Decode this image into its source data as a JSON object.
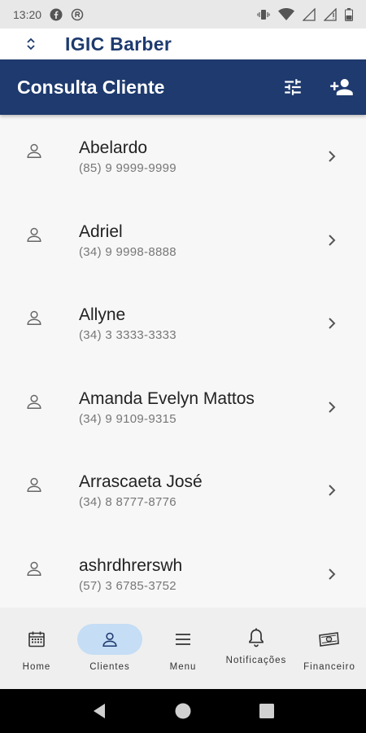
{
  "status_bar": {
    "time": "13:20",
    "icons": [
      "facebook-icon",
      "data-saver-icon",
      "vibrate-icon",
      "wifi-icon",
      "signal-icon",
      "battery-icon"
    ]
  },
  "app_bar": {
    "title": "IGIC Barber",
    "switch_icon": "unfold-icon"
  },
  "header": {
    "title": "Consulta Cliente",
    "filter_icon": "tune-icon",
    "add_icon": "person-add-icon"
  },
  "clients": [
    {
      "name": "Abelardo",
      "phone": "(85) 9 9999-9999"
    },
    {
      "name": "Adriel",
      "phone": "(34) 9 9998-8888"
    },
    {
      "name": "Allyne",
      "phone": "(34) 3 3333-3333"
    },
    {
      "name": "Amanda Evelyn Mattos",
      "phone": "(34) 9 9109-9315"
    },
    {
      "name": "Arrascaeta José",
      "phone": "(34) 8 8777-8776"
    },
    {
      "name": "ashrdhrerswh",
      "phone": "(57) 3 6785-3752"
    }
  ],
  "bottom_nav": [
    {
      "label": "Home",
      "icon": "calendar-icon"
    },
    {
      "label": "Clientes",
      "icon": "person-icon",
      "active": true
    },
    {
      "label": "Menu",
      "icon": "menu-icon"
    },
    {
      "label": "Notificações",
      "icon": "bell-icon"
    },
    {
      "label": "Financeiro",
      "icon": "money-icon"
    }
  ],
  "colors": {
    "primary": "#1e3a6e",
    "active_pill": "#c5ddf5",
    "nav_bg": "#efefef",
    "list_bg": "#f7f7f7"
  }
}
